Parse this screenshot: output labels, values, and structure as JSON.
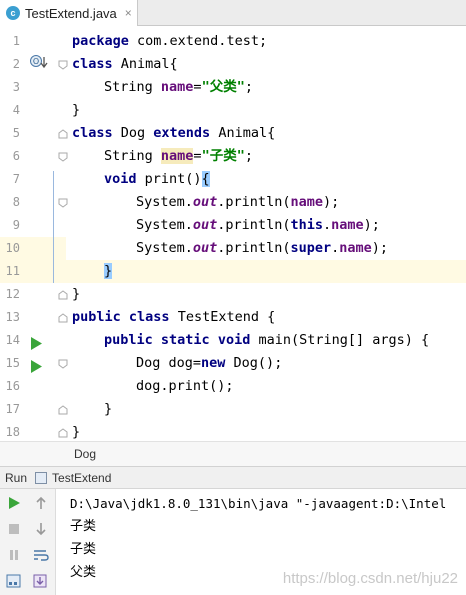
{
  "tab": {
    "icon_letter": "c",
    "filename": "TestExtend.java",
    "close": "×"
  },
  "lines": [
    {
      "num": "1"
    },
    {
      "num": "2"
    },
    {
      "num": "3"
    },
    {
      "num": "4"
    },
    {
      "num": "5"
    },
    {
      "num": "6"
    },
    {
      "num": "7"
    },
    {
      "num": "8"
    },
    {
      "num": "9"
    },
    {
      "num": "10"
    },
    {
      "num": "11"
    },
    {
      "num": "12"
    },
    {
      "num": "13"
    },
    {
      "num": "14"
    },
    {
      "num": "15"
    },
    {
      "num": "16"
    },
    {
      "num": "17"
    },
    {
      "num": "18"
    }
  ],
  "code": {
    "l1": {
      "kw": "package",
      "rest": " com.extend.test;"
    },
    "l2": {
      "kw": "class",
      "rest": " Animal{"
    },
    "l3": {
      "t1": "String ",
      "fld": "name",
      "eq": "=",
      "str": "\"父类\"",
      "end": ";"
    },
    "l4": {
      "t": "}"
    },
    "l5": {
      "kw": "class",
      "t1": " Dog ",
      "kw2": "extends",
      "t2": " Animal{"
    },
    "l6": {
      "t1": "String ",
      "fld": "name",
      "eq": "=",
      "str": "\"子类\"",
      "end": ";"
    },
    "l7": {
      "kw": "void",
      "t1": " print()",
      "brace": "{"
    },
    "l8": {
      "t1": "System.",
      "sf": "out",
      "t2": ".println(",
      "fld": "name",
      "t3": ");"
    },
    "l9": {
      "t1": "System.",
      "sf": "out",
      "t2": ".println(",
      "kw": "this",
      "dot": ".",
      "fld": "name",
      "t3": ");"
    },
    "l10": {
      "t1": "System.",
      "sf": "out",
      "t2": ".println(",
      "kw": "super",
      "dot": ".",
      "fld": "name",
      "t3": ");"
    },
    "l11": {
      "brace": "}"
    },
    "l12": {
      "t": "}"
    },
    "l13": {
      "kw": "public",
      "sp": " ",
      "kw2": "class",
      "t1": " TestExtend {"
    },
    "l14": {
      "kw": "public",
      "sp": " ",
      "kw2": "static",
      "sp2": " ",
      "kw3": "void",
      "t1": " main(String[] args) {"
    },
    "l15": {
      "t1": "Dog dog=",
      "kw": "new",
      "t2": " Dog();"
    },
    "l16": {
      "t1": "dog.print();"
    },
    "l17": {
      "t": "}"
    },
    "l18": {
      "t": "}"
    }
  },
  "breadcrumb": "Dog",
  "run": {
    "label": "Run",
    "config": "TestExtend"
  },
  "console": [
    "D:\\Java\\jdk1.8.0_131\\bin\\java \"-javaagent:D:\\Intel",
    "子类",
    "子类",
    "父类"
  ],
  "watermark": "https://blog.csdn.net/hju22",
  "colors": {
    "keyword": "#000080",
    "string": "#008000",
    "field": "#660e7a",
    "run_green": "#3aa53a"
  }
}
